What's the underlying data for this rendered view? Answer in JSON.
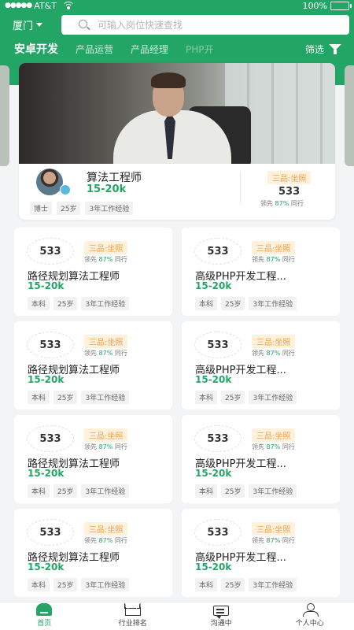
{
  "status_bar": {
    "carrier": "AT&T",
    "battery": "100%"
  },
  "search": {
    "city": "厦门",
    "placeholder": "可输入岗位快速查找"
  },
  "tabs": [
    {
      "label": "安卓开发",
      "active": true
    },
    {
      "label": "产品运营",
      "active": false
    },
    {
      "label": "产品经理",
      "active": false
    },
    {
      "label": "PHP开",
      "active": false
    }
  ],
  "filter_label": "筛选",
  "featured": {
    "title": "算法工程师",
    "salary": "15-20k",
    "tags": [
      "博士",
      "25岁",
      "3年工作经验"
    ],
    "rank_label": "三品:坐照",
    "score": "533",
    "lead_prefix": "领先",
    "lead_pct": "87%",
    "lead_suffix": "同行"
  },
  "cards": [
    {
      "score": "533",
      "rank_label": "三品:坐照",
      "lead_prefix": "领先",
      "lead_pct": "87%",
      "lead_suffix": "同行",
      "title": "路径规划算法工程师",
      "salary": "15-20k",
      "tags": [
        "本科",
        "25岁",
        "3年工作经验"
      ]
    },
    {
      "score": "533",
      "rank_label": "三品:坐照",
      "lead_prefix": "领先",
      "lead_pct": "87%",
      "lead_suffix": "同行",
      "title": "高级PHP开发工程...",
      "salary": "15-20k",
      "tags": [
        "本科",
        "25岁",
        "3年工作经验"
      ]
    },
    {
      "score": "533",
      "rank_label": "三品:坐照",
      "lead_prefix": "领先",
      "lead_pct": "87%",
      "lead_suffix": "同行",
      "title": "路径规划算法工程师",
      "salary": "15-20k",
      "tags": [
        "本科",
        "25岁",
        "3年工作经验"
      ]
    },
    {
      "score": "533",
      "rank_label": "三品:坐照",
      "lead_prefix": "领先",
      "lead_pct": "87%",
      "lead_suffix": "同行",
      "title": "高级PHP开发工程...",
      "salary": "15-20k",
      "tags": [
        "本科",
        "25岁",
        "3年工作经验"
      ]
    },
    {
      "score": "533",
      "rank_label": "三品:坐照",
      "lead_prefix": "领先",
      "lead_pct": "87%",
      "lead_suffix": "同行",
      "title": "路径规划算法工程师",
      "salary": "15-20k",
      "tags": [
        "本科",
        "25岁",
        "3年工作经验"
      ]
    },
    {
      "score": "533",
      "rank_label": "三品:坐照",
      "lead_prefix": "领先",
      "lead_pct": "87%",
      "lead_suffix": "同行",
      "title": "高级PHP开发工程...",
      "salary": "15-20k",
      "tags": [
        "本科",
        "25岁",
        "3年工作经验"
      ]
    },
    {
      "score": "533",
      "rank_label": "三品:坐照",
      "lead_prefix": "领先",
      "lead_pct": "87%",
      "lead_suffix": "同行",
      "title": "路径规划算法工程师",
      "salary": "15-20k",
      "tags": [
        "本科",
        "25岁",
        "3年工作经验"
      ]
    },
    {
      "score": "533",
      "rank_label": "三品:坐照",
      "lead_prefix": "领先",
      "lead_pct": "87%",
      "lead_suffix": "同行",
      "title": "高级PHP开发工程...",
      "salary": "15-20k",
      "tags": [
        "本科",
        "25岁",
        "3年工作经验"
      ]
    }
  ],
  "bottom_nav": [
    {
      "label": "首页",
      "icon": "home-icon",
      "active": true
    },
    {
      "label": "行业排名",
      "icon": "crown-icon",
      "active": false
    },
    {
      "label": "沟通中",
      "icon": "chat-icon",
      "active": false
    },
    {
      "label": "个人中心",
      "icon": "person-icon",
      "active": false
    }
  ],
  "colors": {
    "brand_green": "#22a565",
    "rank_orange": "#f0a14a"
  }
}
